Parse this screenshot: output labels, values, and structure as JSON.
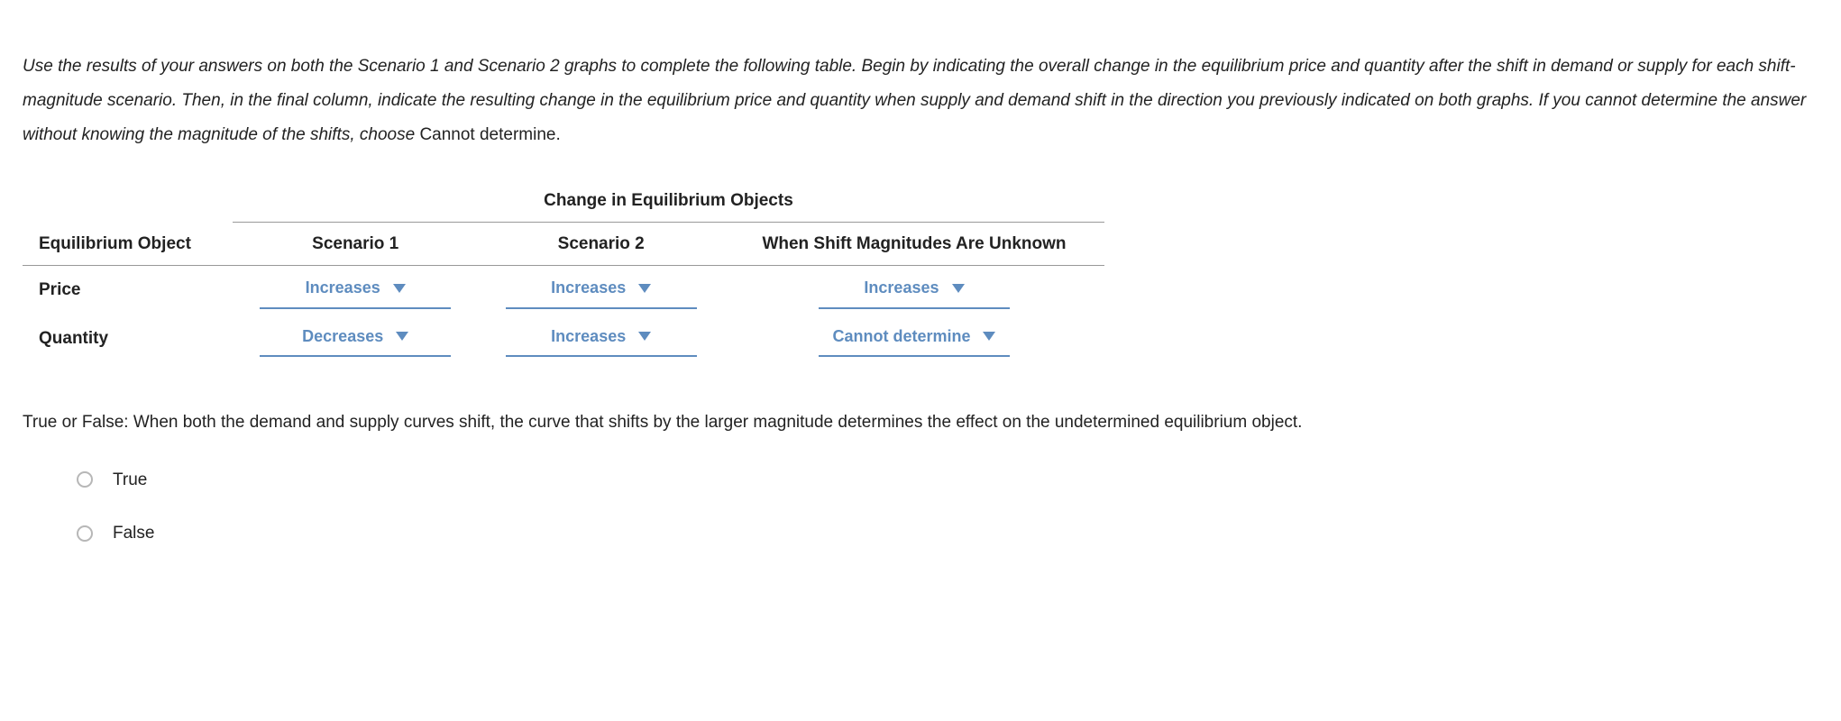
{
  "instructions": {
    "italic_leading": "Use the results of your answers on both the Scenario 1 and Scenario 2 graphs to complete the following table. Begin by indicating the overall change in the equilibrium price and quantity after the shift in demand or supply for each shift-magnitude scenario. Then, in the final column, indicate the resulting change in the equilibrium price and quantity when supply and demand shift in the direction you previously indicated on both graphs. If you cannot determine the answer without knowing the magnitude of the shifts, choose ",
    "plain_tail": "Cannot determine."
  },
  "table": {
    "super_header": "Change in Equilibrium Objects",
    "col_headers": {
      "object": "Equilibrium Object",
      "scenario1": "Scenario 1",
      "scenario2": "Scenario 2",
      "unknown": "When Shift Magnitudes Are Unknown"
    },
    "rows": [
      {
        "label": "Price",
        "scenario1": "Increases",
        "scenario2": "Increases",
        "unknown": "Increases"
      },
      {
        "label": "Quantity",
        "scenario1": "Decreases",
        "scenario2": "Increases",
        "unknown": "Cannot determine"
      }
    ]
  },
  "tf_question": "True or False: When both the demand and supply curves shift, the curve that shifts by the larger magnitude determines the effect on the undetermined equilibrium object.",
  "options": {
    "true_label": "True",
    "false_label": "False"
  }
}
